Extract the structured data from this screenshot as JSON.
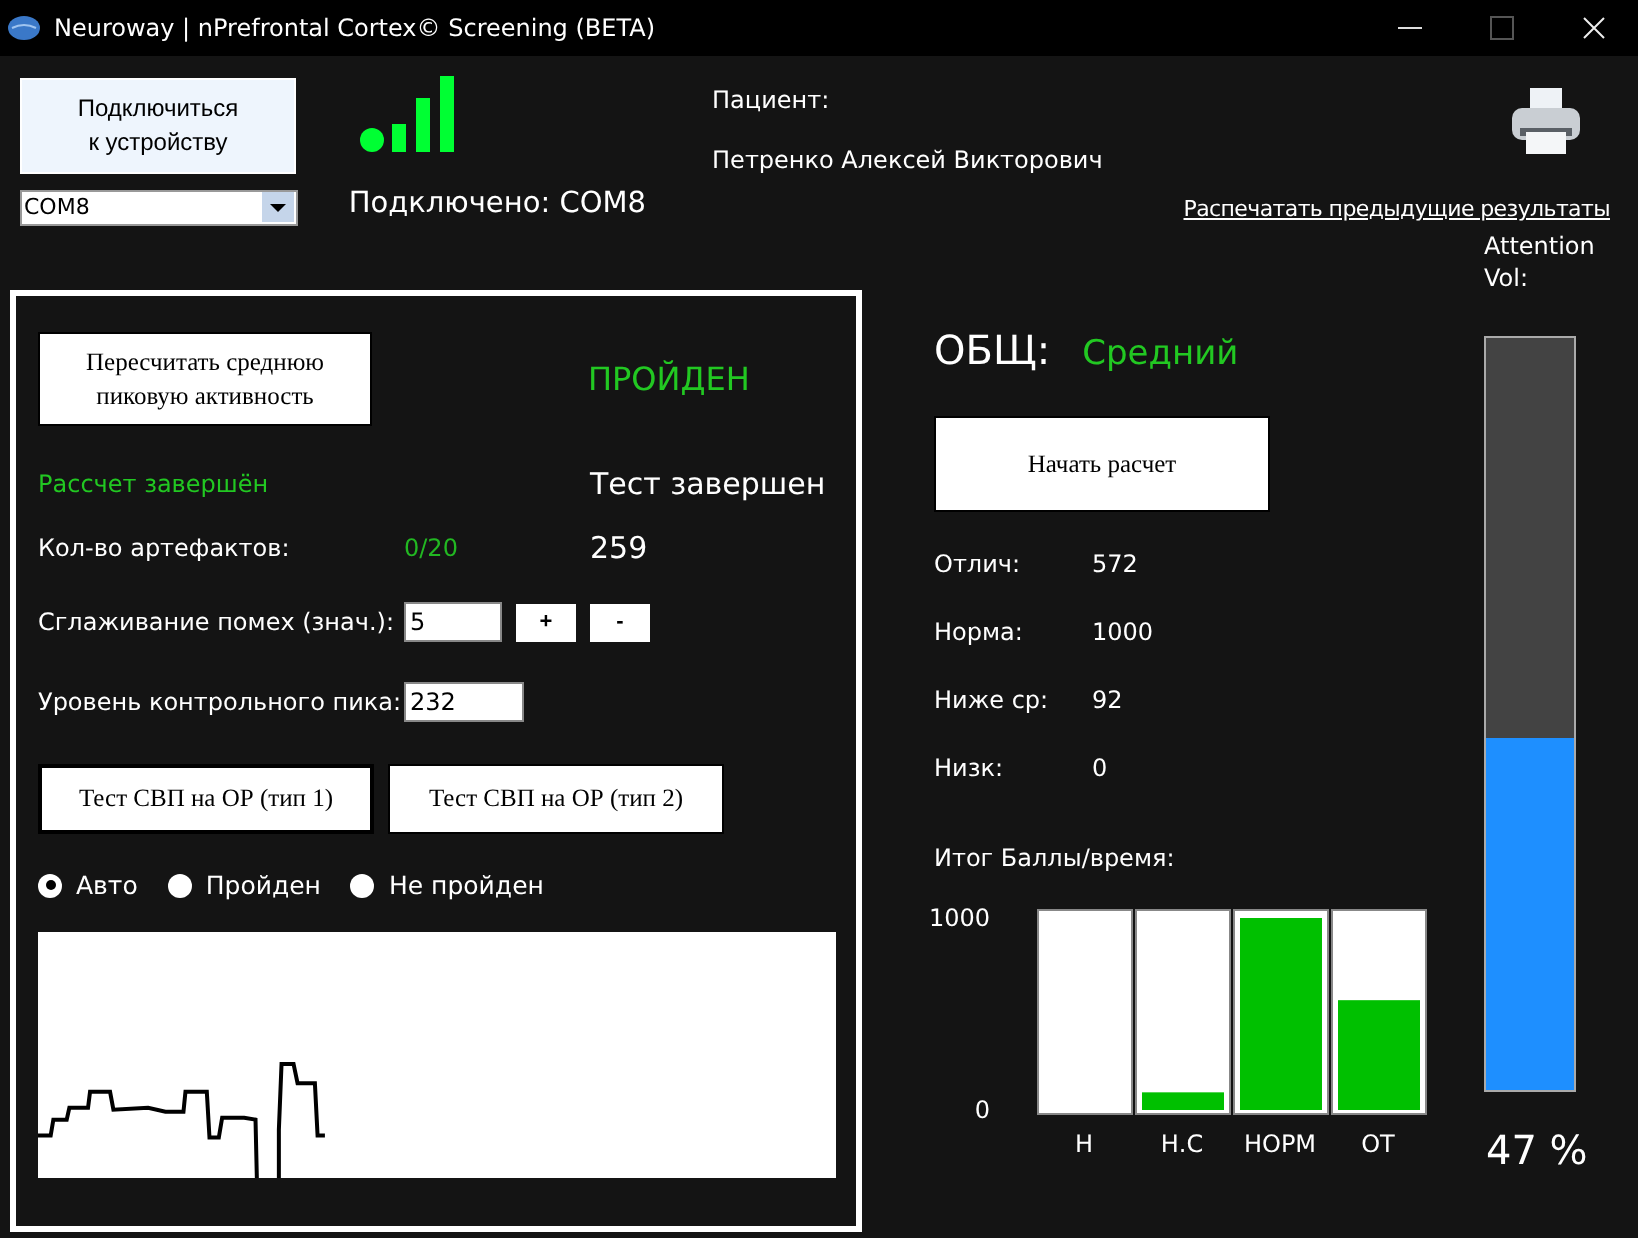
{
  "window": {
    "title": "Neuroway | nPrefrontal Cortex© Screening (BETA)"
  },
  "connection": {
    "button": "Подключиться к устройству",
    "port": "COM8",
    "status": "Подключено: COM8"
  },
  "patient": {
    "label": "Пациент:",
    "name": "Петренко Алексей Викторович"
  },
  "print_link": "Распечатать предыдущие результаты",
  "test_panel": {
    "recalc_button": "Пересчитать среднюю пиковую активность",
    "result": "ПРОЙДЕН",
    "calc_status": "Рассчет завершён",
    "test_status": "Тест завершен",
    "artifacts_label": "Кол-во артефактов:",
    "artifacts_value": "0/20",
    "count": "259",
    "smoothing_label": "Сглаживание помех (знач.):",
    "smoothing_value": "5",
    "plus": "+",
    "minus": "-",
    "peak_label": "Уровень контрольного пика:",
    "peak_value": "232",
    "test_buttons": [
      "Тест СВП на ОР (тип 1)",
      "Тест СВП на ОР (тип 2)"
    ],
    "radios": [
      {
        "label": "Авто",
        "selected": true
      },
      {
        "label": "Пройден",
        "selected": false
      },
      {
        "label": "Не пройден",
        "selected": false
      }
    ]
  },
  "summary": {
    "label": "ОБЩ:",
    "value": "Средний",
    "start_button": "Начать расчет",
    "stats": [
      {
        "label": "Отлич:",
        "value": "572"
      },
      {
        "label": "Норма:",
        "value": "1000"
      },
      {
        "label": "Ниже ср:",
        "value": "92"
      },
      {
        "label": "Низк:",
        "value": "0"
      }
    ],
    "chart_title": "Итог Баллы/время:",
    "chart_data": {
      "type": "bar",
      "categories": [
        "Н",
        "Н.С",
        "НОРМ",
        "ОТ"
      ],
      "values": [
        0,
        92,
        1000,
        572
      ],
      "ylim": [
        0,
        1000
      ],
      "yticks": [
        0,
        1000
      ]
    }
  },
  "attention": {
    "label": "Attention Vol:",
    "level": 0.47,
    "reading": "47 %"
  }
}
